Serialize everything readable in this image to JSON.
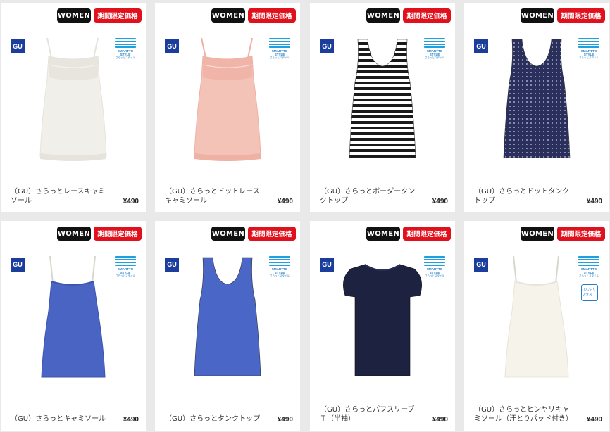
{
  "products": [
    {
      "badge_women": "WOMEN",
      "badge_limited": "期間限定価格",
      "logo": "GU",
      "name": "（GU）さらっとレースキャミソール",
      "price": "¥490",
      "garment": "lace-cami",
      "colors": {
        "body": "#f1efe9",
        "accent": "#e6e3dc"
      }
    },
    {
      "badge_women": "WOMEN",
      "badge_limited": "期間限定価格",
      "logo": "GU",
      "name": "（GU）さらっとドットレースキャミソール",
      "price": "¥490",
      "garment": "lace-cami",
      "colors": {
        "body": "#f4c3b8",
        "accent": "#eeb1a4"
      }
    },
    {
      "badge_women": "WOMEN",
      "badge_limited": "期間限定価格",
      "logo": "GU",
      "name": "（GU）さらっとボーダータンクトップ",
      "price": "¥490",
      "garment": "tank-stripe",
      "colors": {
        "body": "#1a1a1a",
        "accent": "#ffffff"
      }
    },
    {
      "badge_women": "WOMEN",
      "badge_limited": "期間限定価格",
      "logo": "GU",
      "name": "（GU）さらっとドットタンクトップ",
      "price": "¥490",
      "garment": "tank-dot",
      "colors": {
        "body": "#2a2f5c",
        "accent": "#c9cde8"
      }
    },
    {
      "badge_women": "WOMEN",
      "badge_limited": "期間限定価格",
      "logo": "GU",
      "name": "（GU）さらっとキャミソール",
      "price": "¥490",
      "garment": "cami",
      "colors": {
        "body": "#4a64c4",
        "accent": "#3d55ad"
      }
    },
    {
      "badge_women": "WOMEN",
      "badge_limited": "期間限定価格",
      "logo": "GU",
      "name": "（GU）さらっとタンクトップ",
      "price": "¥490",
      "garment": "tank",
      "colors": {
        "body": "#4a66c6",
        "accent": "#3c55ad"
      }
    },
    {
      "badge_women": "WOMEN",
      "badge_limited": "期間限定価格",
      "logo": "GU",
      "name": "（GU）さらっとパフスリーブＴ（半袖）",
      "price": "¥490",
      "garment": "puff-tee",
      "colors": {
        "body": "#1d2240",
        "accent": "#2b3156"
      }
    },
    {
      "badge_women": "WOMEN",
      "badge_limited": "期間限定価格",
      "logo": "GU",
      "name": "（GU）さらっとヒンヤリキャミソール（汗とりパッド付き）",
      "price": "¥490",
      "garment": "cami",
      "colors": {
        "body": "#f6f3ea",
        "accent": "#e8e4d8"
      },
      "extra_badge": "ひんやりプラス"
    }
  ],
  "smartto": {
    "title": "SMARTTO STYLE",
    "sub": "さらっとスタイル"
  },
  "icons": {
    "gu_logo": "gu-logo-icon",
    "smartto": "smartto-style-icon"
  }
}
